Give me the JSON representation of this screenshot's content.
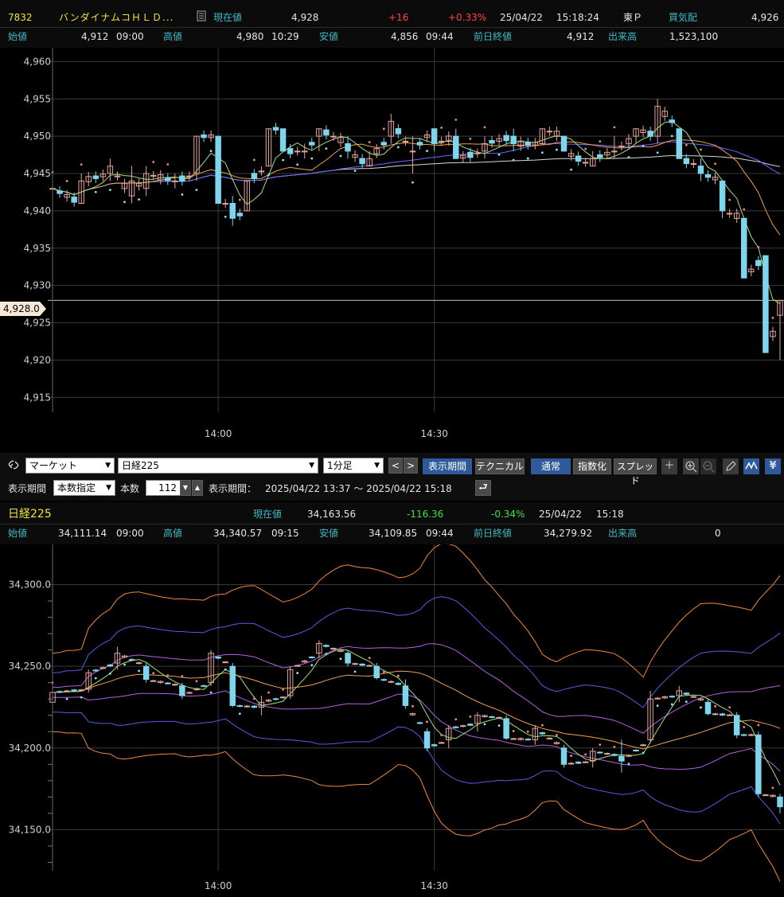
{
  "stock_header": {
    "code": "7832",
    "name": "バンダイナムコＨＬＤ...",
    "current_label": "現在値",
    "current_value": "4,928",
    "change": "+16",
    "change_pct": "+0.33%",
    "date": "25/04/22",
    "time": "15:18:24",
    "market": "東Ｐ",
    "bid_label": "買気配",
    "bid_value": "4,926",
    "open_label": "始値",
    "open_value": "4,912",
    "open_time": "09:00",
    "high_label": "高値",
    "high_value": "4,980",
    "high_time": "10:29",
    "low_label": "安値",
    "low_value": "4,856",
    "low_time": "09:44",
    "prev_label": "前日終値",
    "prev_value": "4,912",
    "volume_label": "出来高",
    "volume_value": "1,523,100"
  },
  "chart1_price_tag": "4,928.0",
  "controls": {
    "market_select": "マーケット",
    "symbol_select": "日経225",
    "period_select": "1分足",
    "prev_label": "<",
    "next_label": ">",
    "display_period_btn": "表示期間",
    "technical_btn": "テクニカル",
    "normal_btn": "通常",
    "index_btn": "指数化",
    "spread_btn": "スプレッド",
    "row2_period_label": "表示期間",
    "count_mode_select": "本数指定",
    "count_label": "本数",
    "count_value": "112",
    "period_range_label": "表示期間：",
    "period_range": "2025/04/22 13:37 ～ 2025/04/22 15:18"
  },
  "index_header": {
    "name": "日経225",
    "current_label": "現在値",
    "current_value": "34,163.56",
    "change": "-116.36",
    "change_pct": "-0.34%",
    "date": "25/04/22",
    "time": "15:18",
    "open_label": "始値",
    "open_value": "34,111.14",
    "open_time": "09:00",
    "high_label": "高値",
    "high_value": "34,340.57",
    "high_time": "09:15",
    "low_label": "安値",
    "low_value": "34,109.85",
    "low_time": "09:44",
    "prev_label": "前日終値",
    "prev_value": "34,279.92",
    "volume_label": "出来高",
    "volume_value": "0"
  },
  "colors": {
    "up_candle": "#e8a39a",
    "down_candle": "#7fd6ec",
    "sar_up": "#8fe3f0",
    "sar_down": "#f08a7a",
    "ma_short": "#9ee37d",
    "ma_mid": "#f0a050",
    "ma_long": "#6a6aff",
    "ma_very_long": "#d8d8d8",
    "bb_outer": "#f08a3c",
    "bb_inner": "#b560e0",
    "bb_mid": "#5a5ae6",
    "label_cyan": "#3fb9c6",
    "title_yellow": "#f2e33a"
  },
  "chart_data": [
    {
      "type": "candlestick",
      "title": "7832",
      "x_ticks": [
        "14:00",
        "14:30"
      ],
      "y_ticks": [
        "4,960",
        "4,955",
        "4,950",
        "4,945",
        "4,940",
        "4,935",
        "4,930",
        "4,925",
        "4,920",
        "4,915"
      ],
      "ylim": [
        4913,
        4961
      ],
      "bars_visible": 101,
      "current_price": 4928.0,
      "ohlc_sampled": [
        {
          "t": "13:37",
          "o": 4943,
          "h": 4944,
          "l": 4939,
          "c": 4943
        },
        {
          "t": "13:41",
          "o": 4941,
          "h": 4945,
          "l": 4941,
          "c": 4944
        },
        {
          "t": "13:45",
          "o": 4945,
          "h": 4947,
          "l": 4944,
          "c": 4946
        },
        {
          "t": "13:48",
          "o": 4942,
          "h": 4946,
          "l": 4941,
          "c": 4944
        },
        {
          "t": "13:50",
          "o": 4943,
          "h": 4946,
          "l": 4942,
          "c": 4945
        },
        {
          "t": "13:54",
          "o": 4944,
          "h": 4945,
          "l": 4943,
          "c": 4944
        },
        {
          "t": "13:57",
          "o": 4945,
          "h": 4950,
          "l": 4944,
          "c": 4950
        },
        {
          "t": "14:00",
          "o": 4950,
          "h": 4950,
          "l": 4941,
          "c": 4941
        },
        {
          "t": "14:02",
          "o": 4941,
          "h": 4942,
          "l": 4938,
          "c": 4939
        },
        {
          "t": "14:04",
          "o": 4940,
          "h": 4944,
          "l": 4940,
          "c": 4944
        },
        {
          "t": "14:07",
          "o": 4946,
          "h": 4951,
          "l": 4946,
          "c": 4951
        },
        {
          "t": "14:09",
          "o": 4951,
          "h": 4951,
          "l": 4948,
          "c": 4948
        },
        {
          "t": "14:12",
          "o": 4948,
          "h": 4949,
          "l": 4947,
          "c": 4948
        },
        {
          "t": "14:14",
          "o": 4950,
          "h": 4951,
          "l": 4948,
          "c": 4951
        },
        {
          "t": "14:18",
          "o": 4949,
          "h": 4950,
          "l": 4947,
          "c": 4948
        },
        {
          "t": "14:21",
          "o": 4946,
          "h": 4948,
          "l": 4946,
          "c": 4947
        },
        {
          "t": "14:24",
          "o": 4950,
          "h": 4953,
          "l": 4949,
          "c": 4952
        },
        {
          "t": "14:27",
          "o": 4948,
          "h": 4950,
          "l": 4945,
          "c": 4948
        },
        {
          "t": "14:30",
          "o": 4951,
          "h": 4951,
          "l": 4948,
          "c": 4949
        },
        {
          "t": "14:33",
          "o": 4950,
          "h": 4951,
          "l": 4947,
          "c": 4947
        },
        {
          "t": "14:37",
          "o": 4948,
          "h": 4950,
          "l": 4947,
          "c": 4949
        },
        {
          "t": "14:41",
          "o": 4950,
          "h": 4951,
          "l": 4948,
          "c": 4949
        },
        {
          "t": "14:45",
          "o": 4949,
          "h": 4951,
          "l": 4949,
          "c": 4951
        },
        {
          "t": "14:48",
          "o": 4950,
          "h": 4950,
          "l": 4948,
          "c": 4948
        },
        {
          "t": "14:52",
          "o": 4946,
          "h": 4948,
          "l": 4946,
          "c": 4947
        },
        {
          "t": "14:55",
          "o": 4948,
          "h": 4950,
          "l": 4947,
          "c": 4948
        },
        {
          "t": "14:58",
          "o": 4950,
          "h": 4951,
          "l": 4949,
          "c": 4951
        },
        {
          "t": "15:01",
          "o": 4950,
          "h": 4955,
          "l": 4949,
          "c": 4954
        },
        {
          "t": "15:04",
          "o": 4951,
          "h": 4951,
          "l": 4947,
          "c": 4947
        },
        {
          "t": "15:07",
          "o": 4946,
          "h": 4947,
          "l": 4944,
          "c": 4945
        },
        {
          "t": "15:10",
          "o": 4944,
          "h": 4944,
          "l": 4939,
          "c": 4940
        },
        {
          "t": "15:13",
          "o": 4939,
          "h": 4939,
          "l": 4931,
          "c": 4931
        },
        {
          "t": "15:16",
          "o": 4934,
          "h": 4934,
          "l": 4921,
          "c": 4921
        },
        {
          "t": "15:18",
          "o": 4926,
          "h": 4928,
          "l": 4920,
          "c": 4928
        }
      ],
      "indicators": [
        "MA short (green)",
        "MA mid (orange)",
        "MA long (blue)",
        "MA very long (white)",
        "Parabolic SAR (dots)"
      ]
    },
    {
      "type": "candlestick",
      "title": "日経225",
      "x_ticks": [
        "14:00",
        "14:30"
      ],
      "y_ticks": [
        "34,300.0",
        "34,250.0",
        "34,200.0",
        "34,150.0"
      ],
      "ylim": [
        34120,
        34310
      ],
      "ohlc_sampled": [
        {
          "t": "13:37",
          "o": 34228,
          "h": 34236,
          "l": 34226,
          "c": 34234
        },
        {
          "t": "13:42",
          "o": 34236,
          "h": 34248,
          "l": 34234,
          "c": 34246
        },
        {
          "t": "13:46",
          "o": 34252,
          "h": 34262,
          "l": 34248,
          "c": 34258
        },
        {
          "t": "13:50",
          "o": 34250,
          "h": 34252,
          "l": 34240,
          "c": 34242
        },
        {
          "t": "13:55",
          "o": 34238,
          "h": 34240,
          "l": 34230,
          "c": 34232
        },
        {
          "t": "13:59",
          "o": 34240,
          "h": 34260,
          "l": 34238,
          "c": 34258
        },
        {
          "t": "14:02",
          "o": 34250,
          "h": 34252,
          "l": 34225,
          "c": 34226
        },
        {
          "t": "14:06",
          "o": 34225,
          "h": 34232,
          "l": 34220,
          "c": 34228
        },
        {
          "t": "14:10",
          "o": 34232,
          "h": 34250,
          "l": 34230,
          "c": 34248
        },
        {
          "t": "14:14",
          "o": 34258,
          "h": 34266,
          "l": 34255,
          "c": 34264
        },
        {
          "t": "14:18",
          "o": 34258,
          "h": 34260,
          "l": 34250,
          "c": 34252
        },
        {
          "t": "14:22",
          "o": 34250,
          "h": 34252,
          "l": 34242,
          "c": 34243
        },
        {
          "t": "14:26",
          "o": 34238,
          "h": 34242,
          "l": 34224,
          "c": 34226
        },
        {
          "t": "14:29",
          "o": 34210,
          "h": 34212,
          "l": 34198,
          "c": 34200
        },
        {
          "t": "14:32",
          "o": 34205,
          "h": 34214,
          "l": 34200,
          "c": 34212
        },
        {
          "t": "14:36",
          "o": 34215,
          "h": 34222,
          "l": 34210,
          "c": 34220
        },
        {
          "t": "14:40",
          "o": 34218,
          "h": 34220,
          "l": 34205,
          "c": 34206
        },
        {
          "t": "14:44",
          "o": 34205,
          "h": 34214,
          "l": 34202,
          "c": 34212
        },
        {
          "t": "14:48",
          "o": 34200,
          "h": 34202,
          "l": 34188,
          "c": 34190
        },
        {
          "t": "14:52",
          "o": 34192,
          "h": 34200,
          "l": 34188,
          "c": 34198
        },
        {
          "t": "14:56",
          "o": 34195,
          "h": 34205,
          "l": 34185,
          "c": 34192
        },
        {
          "t": "15:00",
          "o": 34205,
          "h": 34235,
          "l": 34203,
          "c": 34230
        },
        {
          "t": "15:04",
          "o": 34232,
          "h": 34238,
          "l": 34228,
          "c": 34235
        },
        {
          "t": "15:08",
          "o": 34228,
          "h": 34230,
          "l": 34220,
          "c": 34221
        },
        {
          "t": "15:12",
          "o": 34220,
          "h": 34222,
          "l": 34206,
          "c": 34208
        },
        {
          "t": "15:15",
          "o": 34208,
          "h": 34210,
          "l": 34170,
          "c": 34172
        },
        {
          "t": "15:18",
          "o": 34170,
          "h": 34172,
          "l": 34160,
          "c": 34164
        }
      ],
      "indicators": [
        "Bollinger Bands (outer orange, inner purple, mid blue)",
        "MA short (green)",
        "MA mid (orange)",
        "Parabolic SAR (dots)"
      ]
    }
  ]
}
